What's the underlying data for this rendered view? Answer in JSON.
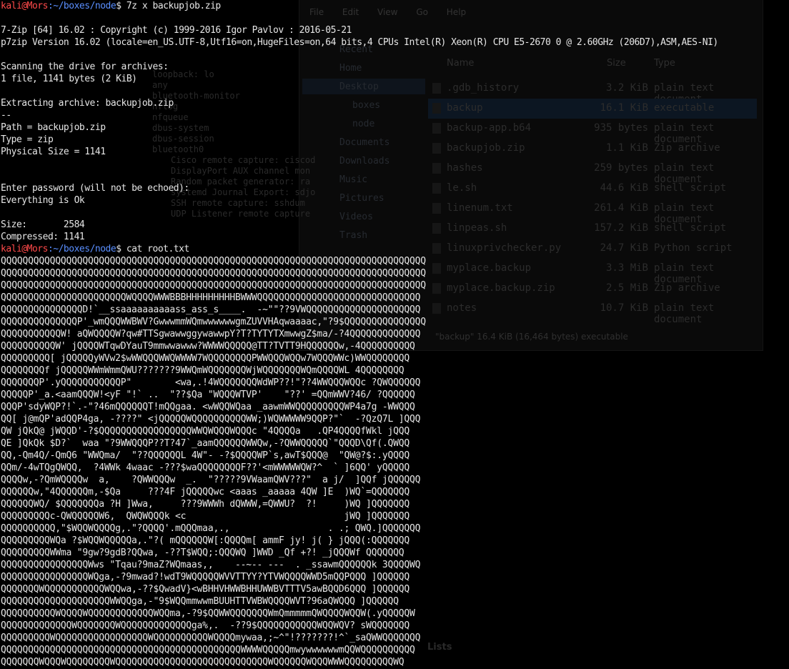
{
  "terminal": {
    "prompt": {
      "user_host": "kali@Mors",
      "path": ":~/boxes/node",
      "dollar": "$ "
    },
    "lines": [
      {
        "prompt": true,
        "cmd": "7z x backupjob.zip"
      },
      {
        "text": ""
      },
      {
        "text": "7-Zip [64] 16.02 : Copyright (c) 1999-2016 Igor Pavlov : 2016-05-21"
      },
      {
        "text": "p7zip Version 16.02 (locale=en_US.UTF-8,Utf16=on,HugeFiles=on,64 bits,4 CPUs Intel(R) Xeon(R) CPU E5-2670 0 @ 2.60GHz (206D7),ASM,AES-NI)"
      },
      {
        "text": ""
      },
      {
        "text": "Scanning the drive for archives:"
      },
      {
        "text": "1 file, 1141 bytes (2 KiB)"
      },
      {
        "text": ""
      },
      {
        "text": "Extracting archive: backupjob.zip"
      },
      {
        "text": "--"
      },
      {
        "text": "Path = backupjob.zip"
      },
      {
        "text": "Type = zip"
      },
      {
        "text": "Physical Size = 1141"
      },
      {
        "text": ""
      },
      {
        "text": ""
      },
      {
        "text": "Enter password (will not be echoed):"
      },
      {
        "text": "Everything is Ok"
      },
      {
        "text": ""
      },
      {
        "text": "Size:       2584"
      },
      {
        "text": "Compressed: 1141"
      },
      {
        "prompt": true,
        "cmd": "cat root.txt"
      }
    ],
    "ascii_art": [
      "QQQQQQQQQQQQQQQQQQQQQQQQQQQQQQQQQQQQQQQQQQQQQQQQQQQQQQQQQQQQQQQQQQQQQQQQQQQQQQ",
      "QQQQQQQQQQQQQQQQQQQQQQQQQQQQQQQQQQQQQQQQQQQQQQQQQQQQQQQQQQQQQQQQQQQQQQQQQQQQQQ",
      "QQQQQQQQQQQQQQQQQQQQQQQQQQQQQQQQQQQQQQQQQQQQQQQQQQQQQQQQQQQQQQQQQQQQQQQQQQQQQQ",
      "QQQQQQQQQQQQQQQQQQQQQQQWQQQQWWWBBBHHHHHHHHHBWWWQQQQQQQQQQQQQQQQQQQQQQQQQQQQQQ",
      "QQQQQQQQQQQQQQQD!`__ssaaaaaaaaaass_ass_s____.  -~\"\"??9VWQQQQQQQQQQQQQQQQQQQQQ",
      "QQQQQQQQQQQQQQP'_wmQQQWWBWV?GwwwmmWQmwwwwwwgmZUVVHAqwaaaac,\"?9$QQQQQQQQQQQQQQQ",
      "QQQQQQQQQQQW! aQWQQQQW?qw#TTSgwawwggywawwpY?T?TYTYTXmwwgZ$ma/-?4QQQQQQQQQQQQQ",
      "QQQQQQQQQQW' jQQQQWTqwDYauT9mmwwawww?WWWWQQQQQ@TT?TVTT9HQQQQQQw,-4QQQQQQQQQQ",
      "QQQQQQQQQ[ jQQQQQyWVw2$wWWQQQWWQWWWW7WQQQQQQQQPWWQQQWQQw7WQQQWWc)WWQQQQQQQQ",
      "QQQQQQQQf jQQQQQWWmWmmQWU???????9WWQmWQQQQQQQWjWQQQQQQQWQmQQQQWL 4QQQQQQQQ",
      "QQQQQQQP'.yQQQQQQQQQQQP\"        <wa,.!4WQQQQQQQWdWP??!\"??4WWQQQWQQc ?QWQQQQQQ",
      "QQQQQP'_a.<aamQQQW!<yF \"!` ..  \"??$Qa \"WQQQWTVP'    \"??' =QQmWWV?46/ ?QQQQQQ",
      "QQQP'sdyWQP?!`.-\"?46mQQQQQQT!mQQgaa. <wWQQWQaa _aawmWWQQQQQQQQQWP4a7g -WWQQQ",
      "QQ[ j@mQP'adQQP4ga, -????\" <jQQQQQWQQQQQQQQQQWW;)WQWWWWW9QQP?\"`  -?QzQ7L ]QQQ",
      "QW jQkQ@ jWQQD'-?$QQQQQQQQQQQQQQQQQWWQWQQQWQQQc \"4QQQQa   .QP4QQQQfWkl jQQQ",
      "QE ]QkQk $D?`  waa \"?9WWQQQP??T?47`_aamQQQQQQWWQw,-?QWWQQQQQ`\"QQQD\\Qf(.QWQQ",
      "QQ,-Qm4Q/-QmQ6 \"WWQma/  \"??QQQQQQL 4W\"- -?$QQQQWP`s,awT$QQQ@  \"QW@?$:.yQQQQ",
      "QQm/-4wTQgQWQQ,  ?4WWk 4waac -???$waQQQQQQQQF??'<mWWWWWQW?^  ` ]6QQ' yQQQQQ",
      "QQQQw,-?QmWQQQQw  a,    ?QWWQQQw  _.  \"?????9VWaamQWV???\"  a j/  ]QQf jQQQQQQ",
      "QQQQQQw,\"4QQQQQQm,-$Qa     ???4F jQQQQQwc <aaas _aaaaa 4QW ]E  )WQ`=QQQQQQQ",
      "QQQQQQWQ/ $QQQQQQQa ?H ]Wwa,     ???9WWWh dQWWW,=QWWU?  ?!     )WQ ]QQQQQQQ",
      "QQQQQQQQQc-QWQQQQQW6,  QWQWQQQk <c                             jWQ ]QQQQQQQ",
      "QQQQQQQQQQ,\"$WQQWQQQQg,.\"?QQQQ'.mQQQmaa,.,                  . .; QWQ.]QQQQQQQ",
      "QQQQQQQQQWQa ?$WQQWQQQQQa,.\"?( mQQQQQQW[:QQQQm[ ammF jy! j( } jQQQ(:QQQQQQQ",
      "QQQQQQQQQWWma \"9gw?9gdB?QQwa, -??T$WQQ;:QQQWQ ]WWD _Qf +?! _jQQQWf QQQQQQQ",
      "QQQQQQQQQQQQQQQQWws \"Tqau?9maZ?WQmaas,,    --~-- ---  . _ssawmQQQQQQk 3QQQQWQ",
      "QQQQQQQQQQQQQQQQWQga,-?9mwad?!wdT9WQQQQQWVVTTYY?YTVWQQQQWWD5mQQPQQQ ]QQQQQQ",
      "QQQQQQQWQQQQQQQQQQQWQQwa,-??$QwadV}<wBHHVHWWBHHUWWBVTTTV5awBQQD6QQQ ]QQQQQQ",
      "QQQQQQQQQQQQQQQQQQQQWWQQga,-\"9$WQQmmwwmBUUHTTVWBWQQQQWVT?96aQWQQQ ]QQQQQQ",
      "QQQQQQQQQQWQQQQWQQQQQQQQQQQQWQQma,-?9$QQWWQQQQQQQWmQmmmmmQWQQQQWQQW(.yQQQQQW",
      "QQQQQQQQQQQQQWQQQQQQQWQQQQQQQQQQQQQga%,.  -??9$QQQQQQQQQQQWQQWQV? sWQQQQQQQ",
      "QQQQQQQQQWQQQQQQQQQQQQQQQQQWQQQQQQQQQQWQQQQmywaa,;~^\"!???????!^`_saQWWQQQQQQQ",
      "QQQQQQQQQQQQQQQQQQQQQQQQQQQQQQQQQQQQQQQQQQQQWWWWQQQQQmwywwwwwwmQQWQQQQQQQQQQ",
      "QQQQQQQWQQQWQQQQQQQQWQQQQQQQQQQQQQQQQQQQQQQQQQQQQWQQQQQQWQQQWWWQQQQQQQQQWQ"
    ]
  },
  "background_file_manager": {
    "menu": [
      "File",
      "Edit",
      "View",
      "Go",
      "Help"
    ],
    "sidebar": [
      "Recent",
      "Home",
      "Desktop",
      "boxes",
      "node",
      "Documents",
      "Downloads",
      "Music",
      "Pictures",
      "Videos",
      "Trash"
    ],
    "columns": {
      "name": "Name",
      "size": "Size",
      "type": "Type"
    },
    "files": [
      {
        "name": ".gdb_history",
        "size": "3.2 KiB",
        "type": "plain text document"
      },
      {
        "name": "backup",
        "size": "16.1 KiB",
        "type": "executable",
        "selected": true
      },
      {
        "name": "backup-app.b64",
        "size": "935 bytes",
        "type": "plain text document"
      },
      {
        "name": "backupjob.zip",
        "size": "1.1 KiB",
        "type": "Zip archive"
      },
      {
        "name": "hashes",
        "size": "259 bytes",
        "type": "plain text document"
      },
      {
        "name": "le.sh",
        "size": "44.6 KiB",
        "type": "shell script"
      },
      {
        "name": "linenum.txt",
        "size": "261.4 KiB",
        "type": "plain text document"
      },
      {
        "name": "linpeas.sh",
        "size": "157.2 KiB",
        "type": "shell script"
      },
      {
        "name": "linuxprivchecker.py",
        "size": "24.7 KiB",
        "type": "Python script"
      },
      {
        "name": "myplace.backup",
        "size": "3.3 MiB",
        "type": "plain text document"
      },
      {
        "name": "myplace.backup.zip",
        "size": "2.5 MiB",
        "type": "Zip archive"
      },
      {
        "name": "notes",
        "size": "10.7 KiB",
        "type": "plain text document"
      }
    ],
    "status": "\"backup\" 16.4 KiB (16,464 bytes) executable"
  },
  "background_capture_list": {
    "items": [
      "loopback: lo",
      "any",
      "bluetooth-monitor",
      "nflog",
      "nfqueue",
      "dbus-system",
      "dbus-session",
      "bluetooth0",
      "Cisco remote capture: ciscod",
      "DisplayPort AUX channel mon",
      "Random packet generator: ra",
      "systemd Journal Export: sdjo",
      "SSH remote capture: sshdum",
      "UDP Listener remote capture"
    ],
    "footer": "Lists"
  }
}
